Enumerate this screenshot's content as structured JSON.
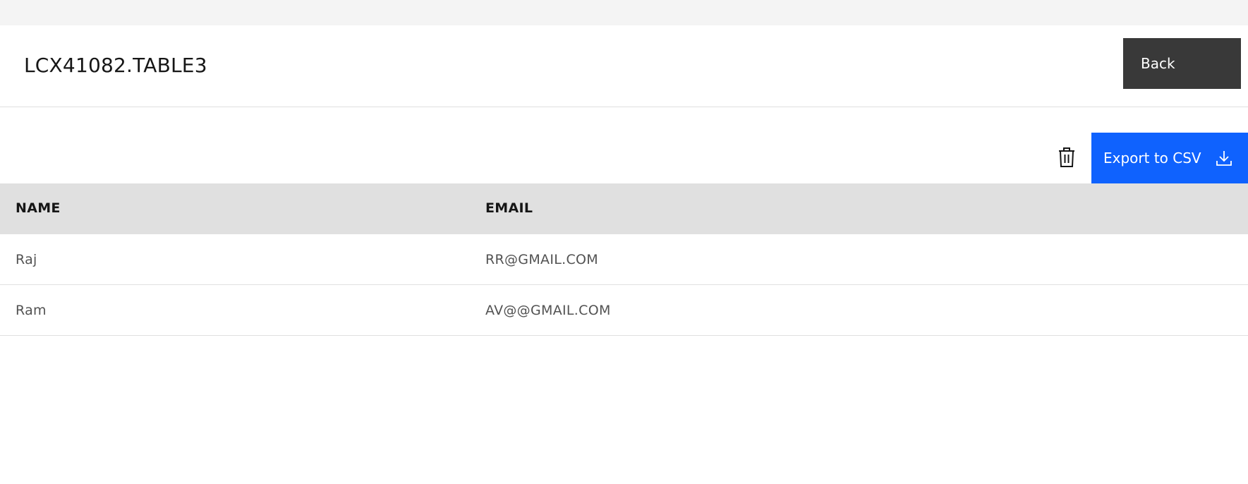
{
  "header": {
    "title": "LCX41082.TABLE3",
    "back_label": "Back"
  },
  "toolbar": {
    "delete_icon": "trash-icon",
    "export_label": "Export to CSV",
    "export_icon": "download-icon",
    "accent_color": "#0f62fe"
  },
  "table": {
    "columns": [
      "NAME",
      "EMAIL"
    ],
    "rows": [
      [
        "Raj",
        "RR@GMAIL.COM"
      ],
      [
        "Ram",
        "AV@@GMAIL.COM"
      ]
    ]
  }
}
